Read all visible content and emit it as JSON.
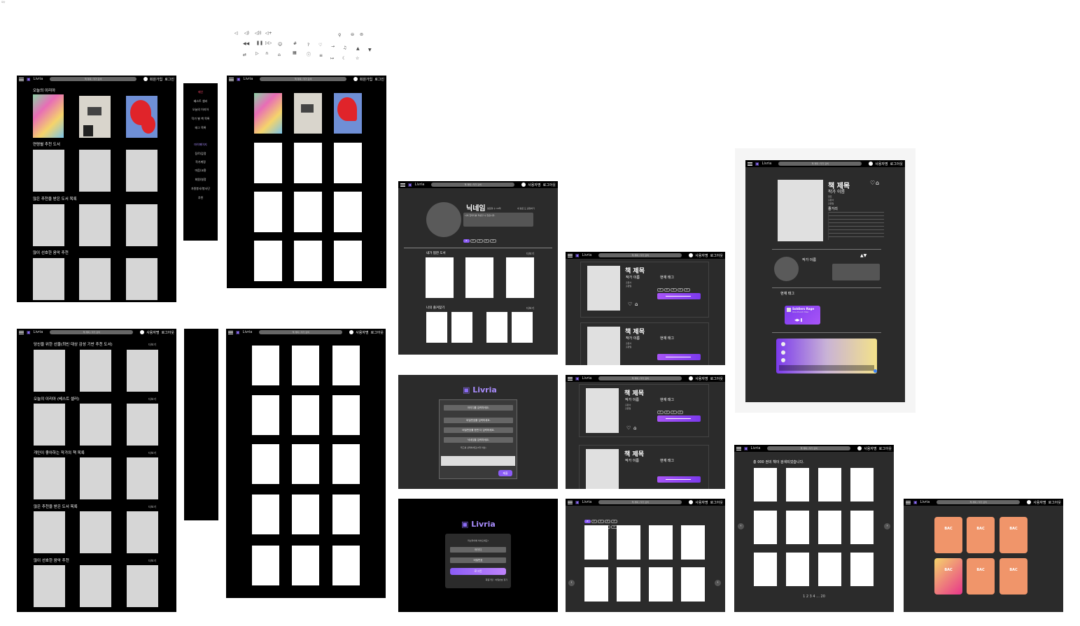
{
  "corner_label": "목차",
  "icons": {
    "row1": [
      "volume-off-icon",
      "volume-low-icon",
      "volume-mid-icon",
      "volume-high-icon"
    ],
    "row2": [
      "rewind-icon",
      "pause-icon",
      "fast-forward-icon",
      "smile-icon",
      "hashtag-icon",
      "help-icon",
      "heart-icon",
      "login-icon",
      "music-icon",
      "thumbs-up-icon",
      "thumbs-down-icon"
    ],
    "row3": [
      "repeat-icon",
      "play-icon",
      "headphones-icon",
      "archive-icon",
      "grid-icon",
      "info-icon",
      "list-icon",
      "logout-icon",
      "moon-icon",
      "star-icon",
      "user-icon",
      "toggle-off-icon",
      "toggle-on-icon"
    ]
  },
  "header": {
    "brand": "Livria",
    "search_placeholder": "책 제목 / 작가 검색",
    "signup": "회원가입",
    "login": "로그인",
    "user_name": "사용자명",
    "logout": "로그아웃"
  },
  "home_guest": {
    "sections": [
      "오늘의 이리아",
      "연령별 추천 도서",
      "많은 추천을 받은 도서 목록",
      "많이 선호한 음악 추천"
    ]
  },
  "home_user": {
    "sections": [
      "당신을 위한 선물(최빈 대상 감성 기반 추천 도서)",
      "오늘의 이리아 (베스트 셀러)",
      "개인이 좋아하는 작가의 책 목록",
      "많은 추천을 받은 도서 목록",
      "많이 선호한 음악 추천"
    ],
    "more": "더보기"
  },
  "sidebar": {
    "items": [
      "메인",
      "베스트 셀러",
      "오늘의 이리아",
      "작가 별 책 목록",
      "태그 목록",
      "마이페이지",
      "장르/감정",
      "작가계정",
      "마음/교환",
      "회원/설정",
      "자원봉사/봉사단",
      "추천"
    ]
  },
  "profile": {
    "nickname": "닉네임",
    "followers": "팔로워 수 10억",
    "following": "내 팔로 도 공정하기",
    "bio": "나의 한마디를 작성할 수 있습니다.",
    "section_liked": "내가 찜한 도서",
    "section_favorites": "나의 즐겨찾기",
    "more": "더보기"
  },
  "book": {
    "title": "책 제목",
    "author": "작가 이름",
    "publisher": "출판사",
    "pubdate": "출판일",
    "genre": "장르",
    "summary": "줄거리",
    "tags_label": "현재 태그",
    "author_section": "작가 이름",
    "current_tags": "현재 태그",
    "music_title": "Soldiers Rage",
    "music_sub": "One Punch Man"
  },
  "signup": {
    "brand": "Livria",
    "id": "아이디를 입력하세요.",
    "password": "비밀번호를 입력하세요.",
    "password_confirm": "비밀번호를 한번 더 입력하세요.",
    "nickname": "닉네임을 입력하세요.",
    "tags_label": "태그를 선택하세요(3개 이상)",
    "submit": "제출"
  },
  "login": {
    "brand": "Livria",
    "prompt": "리브리아에 어서오세요!",
    "id": "아이디",
    "password": "비밀번호",
    "submit": "로그인",
    "links": "회원가입 · 비밀번호 찾기"
  },
  "author_list": {
    "heading": "총 000 권의 책이 검색되었습니다.",
    "pages": "1 2 3 4 ... 20"
  },
  "bac": {
    "label": "BAC"
  }
}
